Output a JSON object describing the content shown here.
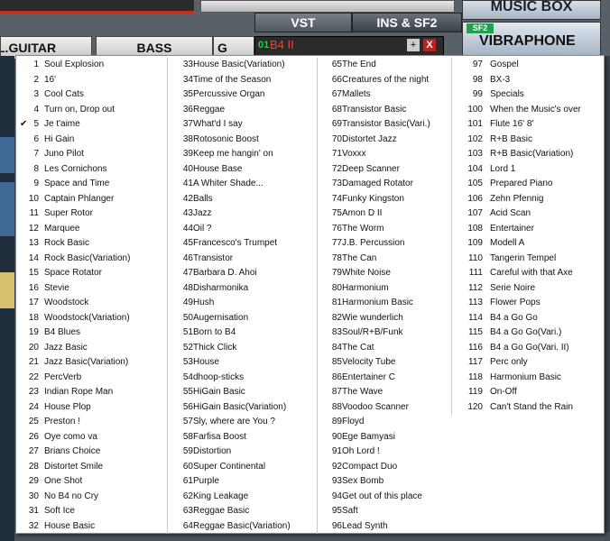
{
  "app": {
    "tabs": [
      "VST",
      "INS & SF2"
    ],
    "music_box_label": "MUSIC BOX",
    "sf2_badge": "SF2",
    "current_sound": "VIBRAPHONE",
    "slot": {
      "number": "01",
      "name": "B4 II",
      "add": "+",
      "remove": "X"
    },
    "side_buttons": [
      "L.GUITAR",
      "BASS",
      "G"
    ]
  },
  "menu": {
    "selected": 5,
    "columns": [
      [
        {
          "n": "1",
          "label": "Soul Explosion"
        },
        {
          "n": "2",
          "label": "16'"
        },
        {
          "n": "3",
          "label": "Cool Cats"
        },
        {
          "n": "4",
          "label": "Turn on, Drop out"
        },
        {
          "n": "5",
          "label": "Je t'aime"
        },
        {
          "n": "6",
          "label": "Hi Gain"
        },
        {
          "n": "7",
          "label": "Juno Pilot"
        },
        {
          "n": "8",
          "label": "Les Cornichons"
        },
        {
          "n": "9",
          "label": "Space and Time"
        },
        {
          "n": "10",
          "label": "Captain Phlanger"
        },
        {
          "n": "11",
          "label": "Super Rotor"
        },
        {
          "n": "12",
          "label": "Marquee"
        },
        {
          "n": "13",
          "label": "Rock Basic"
        },
        {
          "n": "14",
          "label": "Rock Basic(Variation)"
        },
        {
          "n": "15",
          "label": "Space Rotator"
        },
        {
          "n": "16",
          "label": "Stevie"
        },
        {
          "n": "17",
          "label": "Woodstock"
        },
        {
          "n": "18",
          "label": "Woodstock(Variation)"
        },
        {
          "n": "19",
          "label": "B4 Blues"
        },
        {
          "n": "20",
          "label": "Jazz Basic"
        },
        {
          "n": "21",
          "label": "Jazz Basic(Variation)"
        },
        {
          "n": "22",
          "label": "PercVerb"
        },
        {
          "n": "23",
          "label": "Indian Rope Man"
        },
        {
          "n": "24",
          "label": "House Plop"
        },
        {
          "n": "25",
          "label": "Preston !"
        },
        {
          "n": "26",
          "label": "Oye como va"
        },
        {
          "n": "27",
          "label": "Brians Choice"
        },
        {
          "n": "28",
          "label": "Distortet Smile"
        },
        {
          "n": "29",
          "label": "One Shot"
        },
        {
          "n": "30",
          "label": "No B4 no Cry"
        },
        {
          "n": "31",
          "label": "Soft Ice"
        },
        {
          "n": "32",
          "label": "House Basic"
        }
      ],
      [
        {
          "n": "33",
          "label": "House Basic(Variation)"
        },
        {
          "n": "34",
          "label": "Time of the Season"
        },
        {
          "n": "35",
          "label": "Percussive Organ"
        },
        {
          "n": "36",
          "label": "Reggae"
        },
        {
          "n": "37",
          "label": "What'd I say"
        },
        {
          "n": "38",
          "label": "Rotosonic Boost"
        },
        {
          "n": "39",
          "label": "Keep me hangin' on"
        },
        {
          "n": "40",
          "label": "House Base"
        },
        {
          "n": "41",
          "label": "A Whiter Shade..."
        },
        {
          "n": "42",
          "label": "Balls"
        },
        {
          "n": "43",
          "label": "Jazz"
        },
        {
          "n": "44",
          "label": "Oil ?"
        },
        {
          "n": "45",
          "label": "Francesco's Trumpet"
        },
        {
          "n": "46",
          "label": "Transistor"
        },
        {
          "n": "47",
          "label": "Barbara D. Ahoi"
        },
        {
          "n": "48",
          "label": "Disharmonika"
        },
        {
          "n": "49",
          "label": "Hush"
        },
        {
          "n": "50",
          "label": "Augernisation"
        },
        {
          "n": "51",
          "label": "Born to B4"
        },
        {
          "n": "52",
          "label": "Thick Click"
        },
        {
          "n": "53",
          "label": "House"
        },
        {
          "n": "54",
          "label": "dhoop-sticks"
        },
        {
          "n": "55",
          "label": "HiGain Basic"
        },
        {
          "n": "56",
          "label": "HiGain Basic(Variation)"
        },
        {
          "n": "57",
          "label": "Sly, where are You ?"
        },
        {
          "n": "58",
          "label": "Farfisa Boost"
        },
        {
          "n": "59",
          "label": "Distortion"
        },
        {
          "n": "60",
          "label": "Super Continental"
        },
        {
          "n": "61",
          "label": "Purple"
        },
        {
          "n": "62",
          "label": "King Leakage"
        },
        {
          "n": "63",
          "label": "Reggae Basic"
        },
        {
          "n": "64",
          "label": "Reggae Basic(Variation)"
        }
      ],
      [
        {
          "n": "65",
          "label": "The End"
        },
        {
          "n": "66",
          "label": "Creatures of the night"
        },
        {
          "n": "67",
          "label": "Mallets"
        },
        {
          "n": "68",
          "label": "Transistor Basic"
        },
        {
          "n": "69",
          "label": "Transistor Basic(Vari.)"
        },
        {
          "n": "70",
          "label": "Distortet Jazz"
        },
        {
          "n": "71",
          "label": "Voxxx"
        },
        {
          "n": "72",
          "label": "Deep Scanner"
        },
        {
          "n": "73",
          "label": "Damaged Rotator"
        },
        {
          "n": "74",
          "label": "Funky Kingston"
        },
        {
          "n": "75",
          "label": "Amon D II"
        },
        {
          "n": "76",
          "label": "The Worm"
        },
        {
          "n": "77",
          "label": "J.B. Percussion"
        },
        {
          "n": "78",
          "label": "The Can"
        },
        {
          "n": "79",
          "label": "White Noise"
        },
        {
          "n": "80",
          "label": "Harmonium"
        },
        {
          "n": "81",
          "label": "Harmonium Basic"
        },
        {
          "n": "82",
          "label": "Wie wunderlich"
        },
        {
          "n": "83",
          "label": "Soul/R+B/Funk"
        },
        {
          "n": "84",
          "label": "The Cat"
        },
        {
          "n": "85",
          "label": "Velocity Tube"
        },
        {
          "n": "86",
          "label": "Entertainer C"
        },
        {
          "n": "87",
          "label": "The Wave"
        },
        {
          "n": "88",
          "label": "Voodoo Scanner"
        },
        {
          "n": "89",
          "label": "Floyd"
        },
        {
          "n": "90",
          "label": "Ege Bamyasi"
        },
        {
          "n": "91",
          "label": "Oh Lord !"
        },
        {
          "n": "92",
          "label": "Compact Duo"
        },
        {
          "n": "93",
          "label": "Sex Bomb"
        },
        {
          "n": "94",
          "label": "Get out of this place"
        },
        {
          "n": "95",
          "label": "Saft"
        },
        {
          "n": "96",
          "label": "Lead Synth"
        }
      ],
      [
        {
          "n": "97",
          "label": "Gospel"
        },
        {
          "n": "98",
          "label": "BX-3"
        },
        {
          "n": "99",
          "label": "Specials"
        },
        {
          "n": "100",
          "label": "When the Music's over"
        },
        {
          "n": "101",
          "label": "Flute 16' 8'"
        },
        {
          "n": "102",
          "label": "R+B Basic"
        },
        {
          "n": "103",
          "label": "R+B Basic(Variation)"
        },
        {
          "n": "104",
          "label": "Lord 1"
        },
        {
          "n": "105",
          "label": "Prepared Piano"
        },
        {
          "n": "106",
          "label": "Zehn Pfennig"
        },
        {
          "n": "107",
          "label": "Acid Scan"
        },
        {
          "n": "108",
          "label": "Entertainer"
        },
        {
          "n": "109",
          "label": "Modell A"
        },
        {
          "n": "110",
          "label": "Tangerin Tempel"
        },
        {
          "n": "111",
          "label": "Careful with that Axe"
        },
        {
          "n": "112",
          "label": "Serie Noire"
        },
        {
          "n": "113",
          "label": "Flower Pops"
        },
        {
          "n": "114",
          "label": "B4 a Go Go"
        },
        {
          "n": "115",
          "label": "B4 a Go Go(Vari.)"
        },
        {
          "n": "116",
          "label": "B4 a Go Go(Vari. II)"
        },
        {
          "n": "117",
          "label": "Perc only"
        },
        {
          "n": "118",
          "label": "Harmonium Basic"
        },
        {
          "n": "119",
          "label": "On-Off"
        },
        {
          "n": "120",
          "label": "Can't Stand the Rain"
        }
      ]
    ]
  }
}
